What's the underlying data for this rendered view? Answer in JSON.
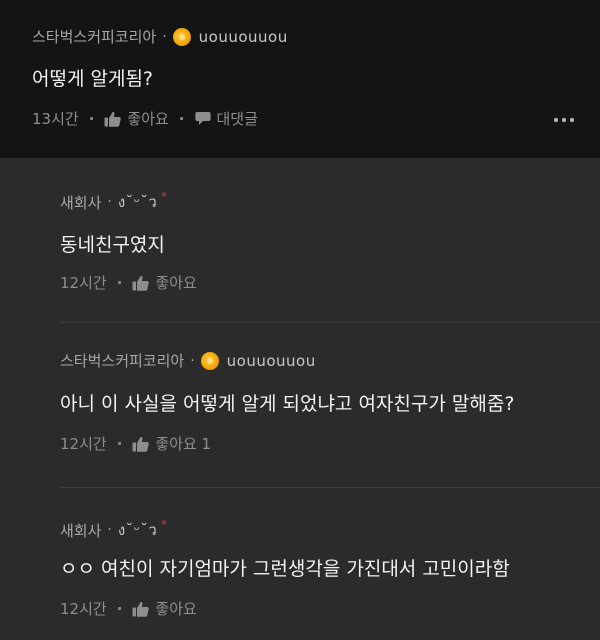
{
  "comments": [
    {
      "author": "스타벅스커피코리아",
      "nickname": "uouuouuou",
      "has_badge": true,
      "text": "어떻게 알게됨?",
      "time": "13시간",
      "like_label": "좋아요",
      "reply_label": "대댓글"
    },
    {
      "author": "새회사",
      "nickname": "ง˘ᵕ˘ว",
      "star": "*",
      "text": "동네친구였지",
      "time": "12시간",
      "like_label": "좋아요"
    },
    {
      "author": "스타벅스커피코리아",
      "nickname": "uouuouuou",
      "has_badge": true,
      "text": "아니 이 사실을 어떻게 알게 되었냐고 여자친구가 말해줌?",
      "time": "12시간",
      "like_label": "좋아요 1"
    },
    {
      "author": "새회사",
      "nickname": "ง˘ᵕ˘ว",
      "star": "*",
      "text": "ㅇㅇ 여친이 자기엄마가 그런생각을 가진대서 고민이라함",
      "time": "12시간",
      "like_label": "좋아요"
    }
  ],
  "separator": "·",
  "icons": {
    "like": "thumbs-up-icon",
    "reply": "speech-bubble-icon",
    "more": "more-dots-icon",
    "badge": "coin-badge-icon"
  },
  "colors": {
    "top_bg": "#141414",
    "reply_bg": "#2b2b2b",
    "text": "#f2f2f2",
    "meta": "#a7a7a7",
    "star": "#e23b3b",
    "badge": "#f2a400"
  }
}
